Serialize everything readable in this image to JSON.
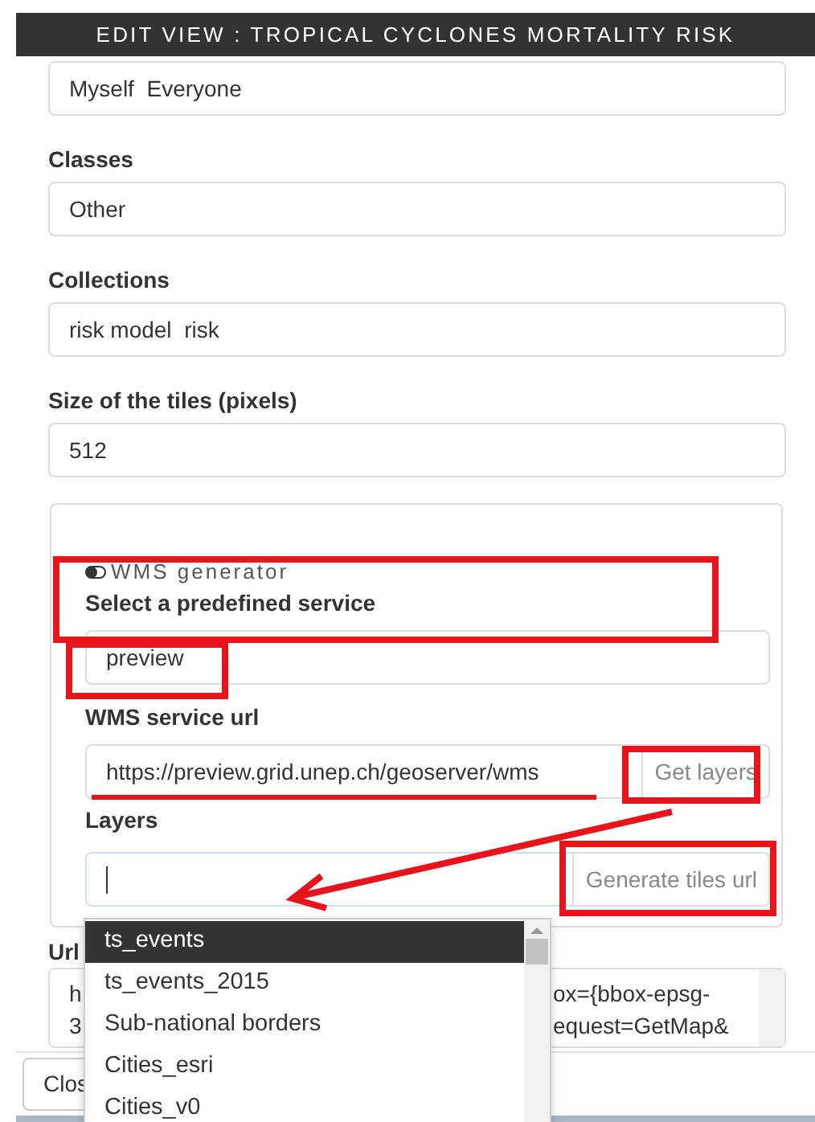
{
  "window": {
    "title": "EDIT VIEW : TROPICAL CYCLONES MORTALITY RISK"
  },
  "fields": [
    {
      "value": "Myself  Everyone"
    },
    {
      "label": "Classes",
      "value": "Other"
    },
    {
      "label": "Collections",
      "value": "risk model  risk"
    },
    {
      "label": "Size of the tiles (pixels)",
      "value": "512"
    }
  ],
  "wms_panel": {
    "toggle_label": "WMS generator",
    "service_label": "Select a predefined service",
    "service_value": "preview",
    "url_label": "WMS service url",
    "url_value": "https://preview.grid.unep.ch/geoserver/wms",
    "get_layers_button": "Get layers",
    "layers_label": "Layers",
    "generate_button": "Generate tiles url"
  },
  "layers_dropdown": [
    {
      "label": "ts_events",
      "selected": true
    },
    {
      "label": "ts_events_2015",
      "selected": false
    },
    {
      "label": "Sub-national borders",
      "selected": false
    },
    {
      "label": "Cities_esri",
      "selected": false
    },
    {
      "label": "Cities_v0",
      "selected": false
    }
  ],
  "url_field": {
    "label": "Url",
    "left_lines": [
      "h",
      "3"
    ],
    "right_lines": [
      "ox={bbox-epsg-",
      "equest=GetMap&"
    ]
  },
  "footer": {
    "close_button": "Clos"
  }
}
